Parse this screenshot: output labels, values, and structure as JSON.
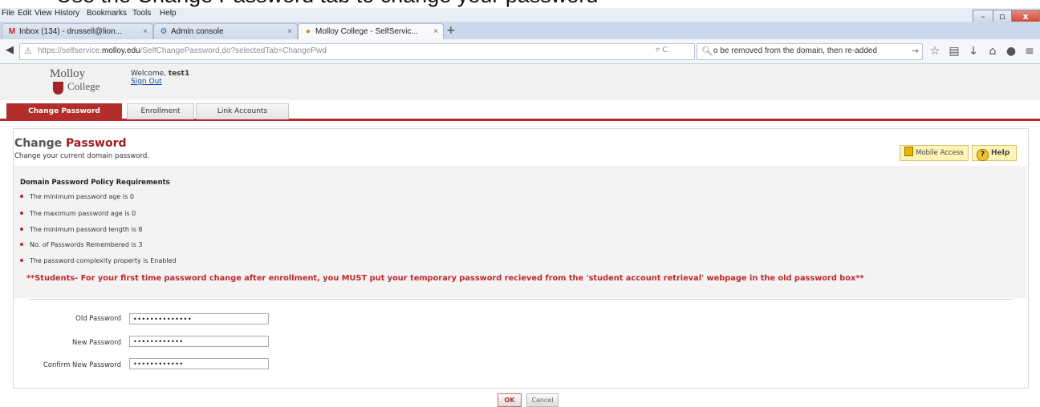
{
  "overlay_caption": "Use the Change Password tab to change your password",
  "browser": {
    "menu": [
      "File",
      "Edit",
      "View",
      "History",
      "Bookmarks",
      "Tools",
      "Help"
    ],
    "tabs": [
      {
        "label": "Inbox (134) - drussell@lion...",
        "icon": "gmail-icon"
      },
      {
        "label": "Admin console",
        "icon": "admin-icon"
      },
      {
        "label": "Molloy College - SelfServic...",
        "icon": "selfservice-icon",
        "active": true
      }
    ],
    "url_prefix": "https://selfservice.",
    "url_domain": "molloy.edu",
    "url_path": "/SelfChangePassword.do?selectedTab=ChangePwd",
    "search_value": "o be removed from the domain, then re-added"
  },
  "header": {
    "logo_line1": "Molloy",
    "logo_line2": "College",
    "welcome_prefix": "Welcome, ",
    "username": "test1",
    "signout_label": "Sign Out"
  },
  "app_tabs": [
    "Change Password",
    "Enrollment",
    "Link Accounts"
  ],
  "page": {
    "title_part1": "Change ",
    "title_part2": "Password",
    "subtitle": "Change your current domain password.",
    "mobile_access_label": "Mobile Access",
    "help_label": "Help",
    "help_icon_glyph": "?"
  },
  "policy": {
    "heading": "Domain Password Policy Requirements",
    "rules": [
      "The minimum password age is 0",
      "The maximum password age is 0",
      "The minimum password length is 8",
      "No. of Passwords Remembered is 3",
      "The password complexity property is Enabled"
    ],
    "student_note": "**Students- For your first time password change after enrollment, you MUST put your temporary password recieved from the 'student account retrieval' webpage in the old password box**"
  },
  "form": {
    "old_password_label": "Old Password",
    "old_password_value": "••••••••••••••",
    "new_password_label": "New Password",
    "new_password_value": "••••••••••••",
    "confirm_password_label": "Confirm New Password",
    "confirm_password_value": "••••••••••••",
    "ok_label": "OK",
    "cancel_label": "Cancel"
  },
  "colors": {
    "accent_red": "#b32d2a",
    "note_red": "#c0272d"
  }
}
